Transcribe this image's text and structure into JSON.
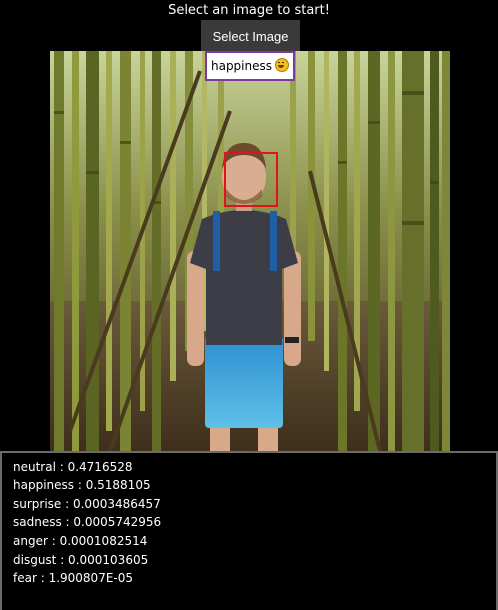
{
  "app": {
    "instruction": "Select an image to start!",
    "select_button_label": "Select Image"
  },
  "detection": {
    "emotion_label": "happiness",
    "emoji_icon": "grinning-face-emoji"
  },
  "results": [
    {
      "emotion": "neutral",
      "score": "0.4716528",
      "text": "neutral : 0.4716528"
    },
    {
      "emotion": "happiness",
      "score": "0.5188105",
      "text": "happiness : 0.5188105"
    },
    {
      "emotion": "surprise",
      "score": "0.0003486457",
      "text": "surprise : 0.0003486457"
    },
    {
      "emotion": "sadness",
      "score": "0.0005742956",
      "text": "sadness : 0.0005742956"
    },
    {
      "emotion": "anger",
      "score": "0.0001082514",
      "text": "anger : 0.0001082514"
    },
    {
      "emotion": "disgust",
      "score": "0.000103605",
      "text": "disgust : 0.000103605"
    },
    {
      "emotion": "fear",
      "score": "1.900807E-05",
      "text": "fear : 1.900807E-05"
    }
  ],
  "colors": {
    "background": "#000000",
    "button_background": "#3a3a3a",
    "label_border": "#7b3a9c",
    "face_box": "#e0141b",
    "results_border": "#6b6b6b"
  }
}
